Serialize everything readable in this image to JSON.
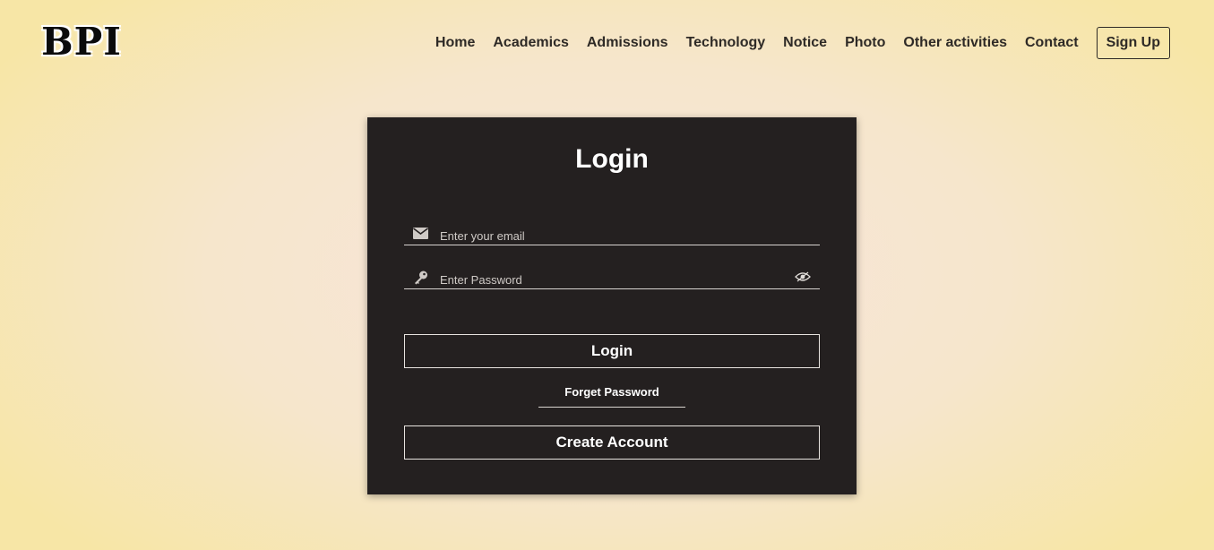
{
  "logo": {
    "text": "BPI"
  },
  "nav": {
    "items": [
      "Home",
      "Academics",
      "Admissions",
      "Technology",
      "Notice",
      "Photo",
      "Other activities",
      "Contact"
    ],
    "signup_label": "Sign Up"
  },
  "login": {
    "title": "Login",
    "email_placeholder": "Enter your email",
    "password_placeholder": "Enter Password",
    "login_button": "Login",
    "forgot_label": "Forget Password",
    "create_button": "Create Account"
  },
  "icons": {
    "email": "envelope-icon",
    "password": "key-icon",
    "visibility": "eye-icon"
  },
  "colors": {
    "card_bg": "#242020",
    "nav_text": "#2e2a26",
    "page_bg_center": "#f8e4dc",
    "page_bg_edge": "#f7e6a6"
  }
}
